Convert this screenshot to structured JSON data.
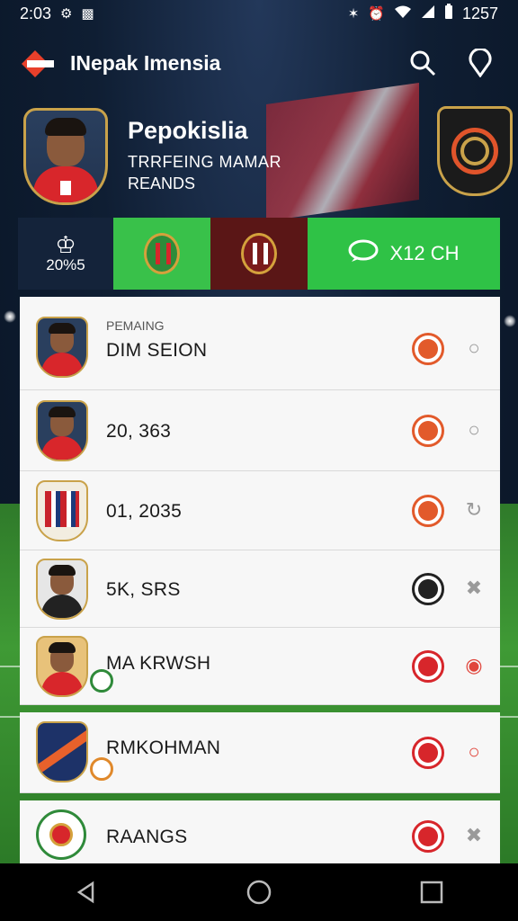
{
  "status_bar": {
    "time": "2:03",
    "right_text": "1257",
    "icons": [
      "settings-icon",
      "notification-icon",
      "bluetooth-icon",
      "alarm-icon",
      "wifi-icon",
      "signal-icon",
      "battery-icon"
    ]
  },
  "app_bar": {
    "title": "INepak Imensia",
    "icons": [
      "logo-icon",
      "search-icon",
      "location-icon"
    ]
  },
  "profile": {
    "name": "Pepokislia",
    "subtitle1": "TRRFEING MAMAR",
    "subtitle2": "REANDS"
  },
  "tabs": [
    {
      "icon": "trophy-icon",
      "label": "20%5"
    },
    {
      "icon": "club-crest-icon",
      "label": ""
    },
    {
      "icon": "club-crest-icon",
      "label": ""
    },
    {
      "icon": "chat-icon",
      "label": "X12 CH"
    }
  ],
  "list": {
    "header_label": "PEMAING",
    "items": [
      {
        "text": "DIM SEION"
      },
      {
        "text": "20, 363"
      },
      {
        "text": "01, 2035"
      },
      {
        "text": "5K, SRS"
      },
      {
        "text": "MA KRWSH"
      },
      {
        "text": "RMKOHMAN"
      },
      {
        "text": "RAANGS"
      }
    ]
  },
  "colors": {
    "accent_green": "#39c14a",
    "accent_red": "#d7262b",
    "gold": "#c9a24a",
    "navy": "#14233a"
  }
}
